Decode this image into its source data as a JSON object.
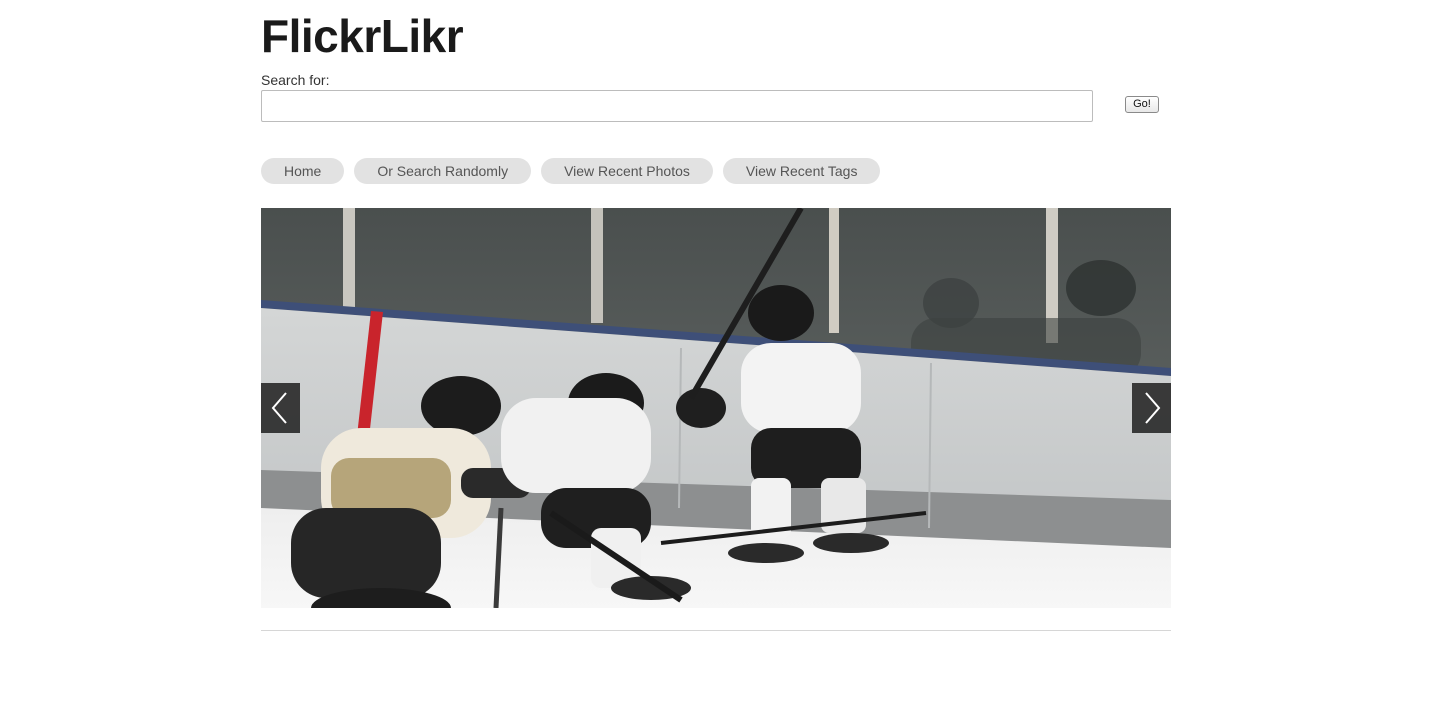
{
  "site": {
    "title": "FlickrLikr"
  },
  "search": {
    "label": "Search for:",
    "value": "",
    "placeholder": "",
    "button_label": "Go!"
  },
  "nav": {
    "items": [
      {
        "label": "Home"
      },
      {
        "label": "Or Search Randomly"
      },
      {
        "label": "View Recent Photos"
      },
      {
        "label": "View Recent Tags"
      }
    ]
  },
  "slider": {
    "photo_subject": "youth ice hockey players near the boards",
    "prev_icon": "chevron-left-icon",
    "next_icon": "chevron-right-icon"
  }
}
